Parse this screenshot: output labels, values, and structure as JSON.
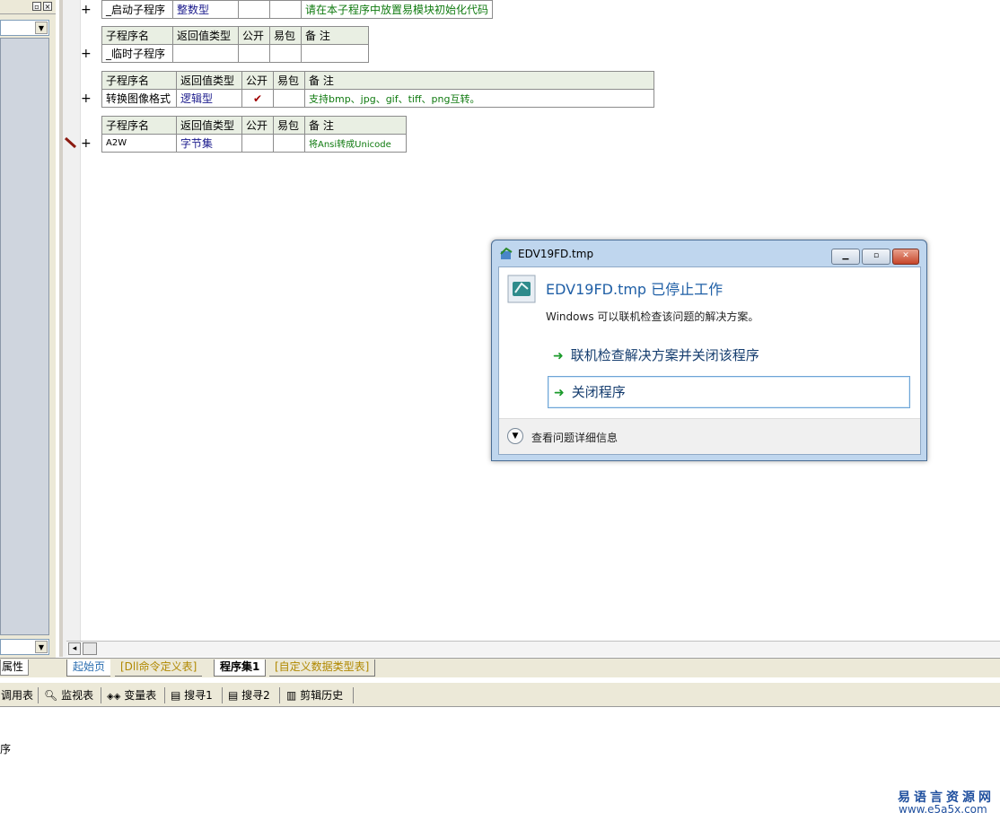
{
  "editor": {
    "plus": "+",
    "tables": [
      {
        "rows": [
          [
            "_启动子程序",
            "整数型",
            "",
            "",
            "请在本子程序中放置易模块初始化代码"
          ]
        ]
      },
      {
        "header": [
          "子程序名",
          "返回值类型",
          "公开",
          "易包",
          "备 注"
        ],
        "rows": [
          [
            "_临时子程序",
            "",
            "",
            "",
            ""
          ]
        ]
      },
      {
        "header": [
          "子程序名",
          "返回值类型",
          "公开",
          "易包",
          "备 注"
        ],
        "rows": [
          [
            "转换图像格式",
            "逻辑型",
            "✔",
            "",
            "支持bmp、jpg、gif、tiff、png互转。"
          ]
        ]
      },
      {
        "header": [
          "子程序名",
          "返回值类型",
          "公开",
          "易包",
          "备 注"
        ],
        "rows": [
          [
            "A2W",
            "字节集",
            "",
            "",
            "将Ansi转成Unicode"
          ]
        ]
      }
    ]
  },
  "left_panel": {
    "properties_tab": "属性"
  },
  "file_tabs": [
    "起始页",
    "[Dll命令定义表]",
    "程序集1",
    "[自定义数据类型表]"
  ],
  "bottom_toolbar": {
    "call_table": "调用表",
    "watch_table": "监视表",
    "var_table": "变量表",
    "search1": "搜寻1",
    "search2": "搜寻2",
    "clip_history": "剪辑历史"
  },
  "output": {
    "line": "序"
  },
  "dialog": {
    "title": "EDV19FD.tmp",
    "heading": "EDV19FD.tmp 已停止工作",
    "message": "Windows 可以联机检查该问题的解决方案。",
    "option_check_online": "联机检查解决方案并关闭该程序",
    "option_close_program": "关闭程序",
    "details": "查看问题详细信息"
  },
  "watermark": {
    "cn": "易语言资源网",
    "url": "www.e5a5x.com"
  },
  "colors": {
    "type_text": "#1a1a8c",
    "note_text": "#0f7a0f",
    "header_bg": "#e9efe3",
    "dialog_heading": "#1f5fa6"
  }
}
